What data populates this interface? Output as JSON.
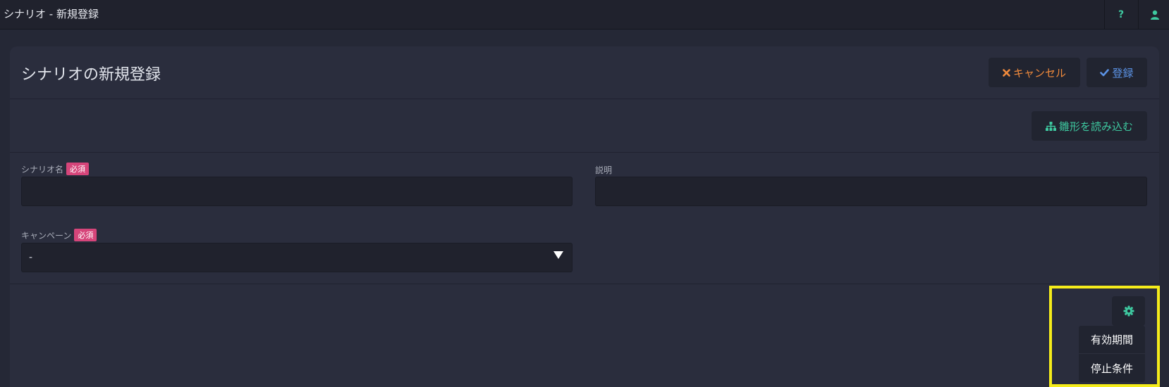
{
  "topbar": {
    "title": "シナリオ - 新規登録",
    "help_icon": "question-icon",
    "user_icon": "user-icon"
  },
  "card": {
    "title": "シナリオの新規登録",
    "cancel_label": "キャンセル",
    "save_label": "登録",
    "template_label": "雛形を読み込む"
  },
  "form": {
    "scenario_name_label": "シナリオ名",
    "required_badge": "必須",
    "description_label": "説明",
    "campaign_label": "キャンペーン",
    "campaign_value": "-"
  },
  "settings_menu": {
    "items": [
      "有効期間",
      "停止条件"
    ]
  },
  "colors": {
    "accent_green": "#3ec9a0",
    "cancel_orange": "#f08a3c",
    "save_blue": "#5b93e6",
    "required_pink": "#d6457a",
    "highlight_yellow": "#f5ec1b"
  }
}
